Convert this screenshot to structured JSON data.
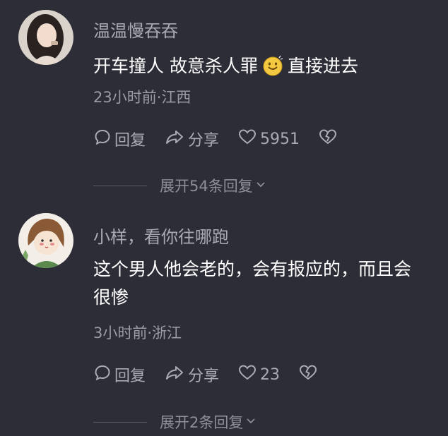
{
  "comments": [
    {
      "username": "温温慢吞吞",
      "text_before": "开车撞人 故意杀人罪",
      "text_after": "直接进去",
      "emoji": "smile-emoji",
      "meta": "23小时前·江西",
      "actions": {
        "reply": "回复",
        "share": "分享",
        "likes": "5951"
      },
      "expand": "展开54条回复"
    },
    {
      "username": "小样，看你往哪跑",
      "text": "这个男人他会老的，会有报应的，而且会很惨",
      "meta": "3小时前·浙江",
      "actions": {
        "reply": "回复",
        "share": "分享",
        "likes": "23"
      },
      "expand": "展开2条回复"
    }
  ],
  "colors": {
    "background": "#2c2d36",
    "muted": "#a9aab3",
    "text": "#ffffff"
  }
}
